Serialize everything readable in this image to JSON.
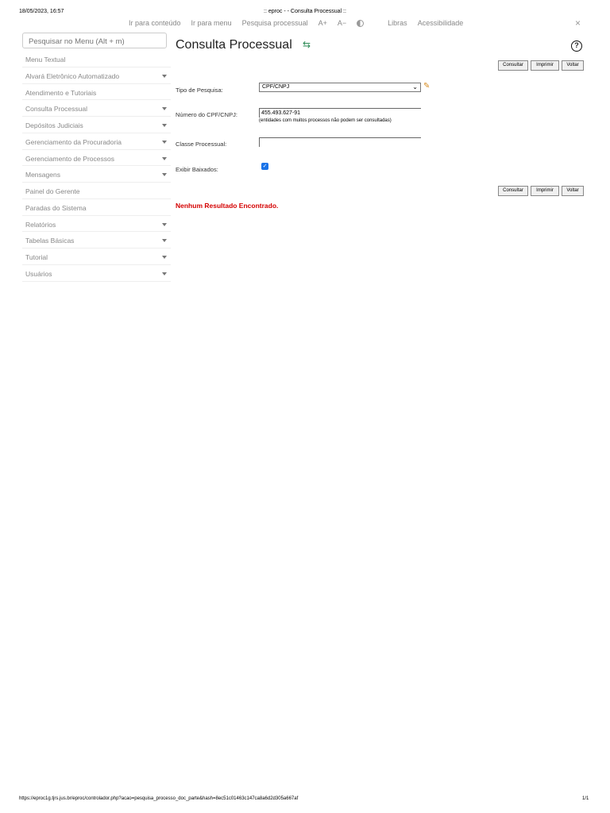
{
  "print": {
    "date": "18/05/2023, 16:57",
    "title": ":: eproc - - Consulta Processual ::",
    "url": "https://eproc1g.tjrs.jus.br/eproc/controlador.php?acao=pesquisa_processo_doc_parte&hash=8ec51c01463c147ca8a6d2d305a667af",
    "page": "1/1"
  },
  "topbar": {
    "links": [
      "Ir para conteúdo",
      "Ir para menu",
      "Pesquisa processual",
      "A+",
      "A−",
      "Libras",
      "Acessibilidade"
    ],
    "close": "×"
  },
  "icons": {
    "contrast": "contrast-icon",
    "close": "close-icon",
    "refresh": "refresh-icon",
    "help": "help-icon",
    "edit": "pencil-icon",
    "caret": "caret-down-icon"
  },
  "sidebar": {
    "search_placeholder": "Pesquisar no Menu (Alt + m)",
    "items": [
      {
        "label": "Menu Textual",
        "has_children": false
      },
      {
        "label": "Alvará Eletrônico Automatizado",
        "has_children": true
      },
      {
        "label": "Atendimento e Tutoriais",
        "has_children": false
      },
      {
        "label": "Consulta Processual",
        "has_children": true
      },
      {
        "label": "Depósitos Judiciais",
        "has_children": true
      },
      {
        "label": "Gerenciamento da Procuradoria",
        "has_children": true
      },
      {
        "label": "Gerenciamento de Processos",
        "has_children": true
      },
      {
        "label": "Mensagens",
        "has_children": true
      },
      {
        "label": "Painel do Gerente",
        "has_children": false
      },
      {
        "label": "Paradas do Sistema",
        "has_children": false
      },
      {
        "label": "Relatórios",
        "has_children": true
      },
      {
        "label": "Tabelas Básicas",
        "has_children": true
      },
      {
        "label": "Tutorial",
        "has_children": true
      },
      {
        "label": "Usuários",
        "has_children": true
      }
    ]
  },
  "main": {
    "title": "Consulta Processual",
    "refresh_glyph": "⇆",
    "help_glyph": "?",
    "buttons": {
      "consultar": "Consultar",
      "imprimir": "Imprimir",
      "voltar": "Voltar"
    },
    "form": {
      "tipo_label": "Tipo de Pesquisa:",
      "tipo_value": "CPF/CNPJ",
      "numero_label": "Número do CPF/CNPJ:",
      "numero_value": "455.493.627-91",
      "numero_hint": "(entidades com muitos processos não podem ser consultadas)",
      "classe_label": "Classe Processual:",
      "classe_value": "",
      "baixados_label": "Exibir Baixados:",
      "baixados_checked": true
    },
    "no_result": "Nenhum Resultado Encontrado."
  }
}
